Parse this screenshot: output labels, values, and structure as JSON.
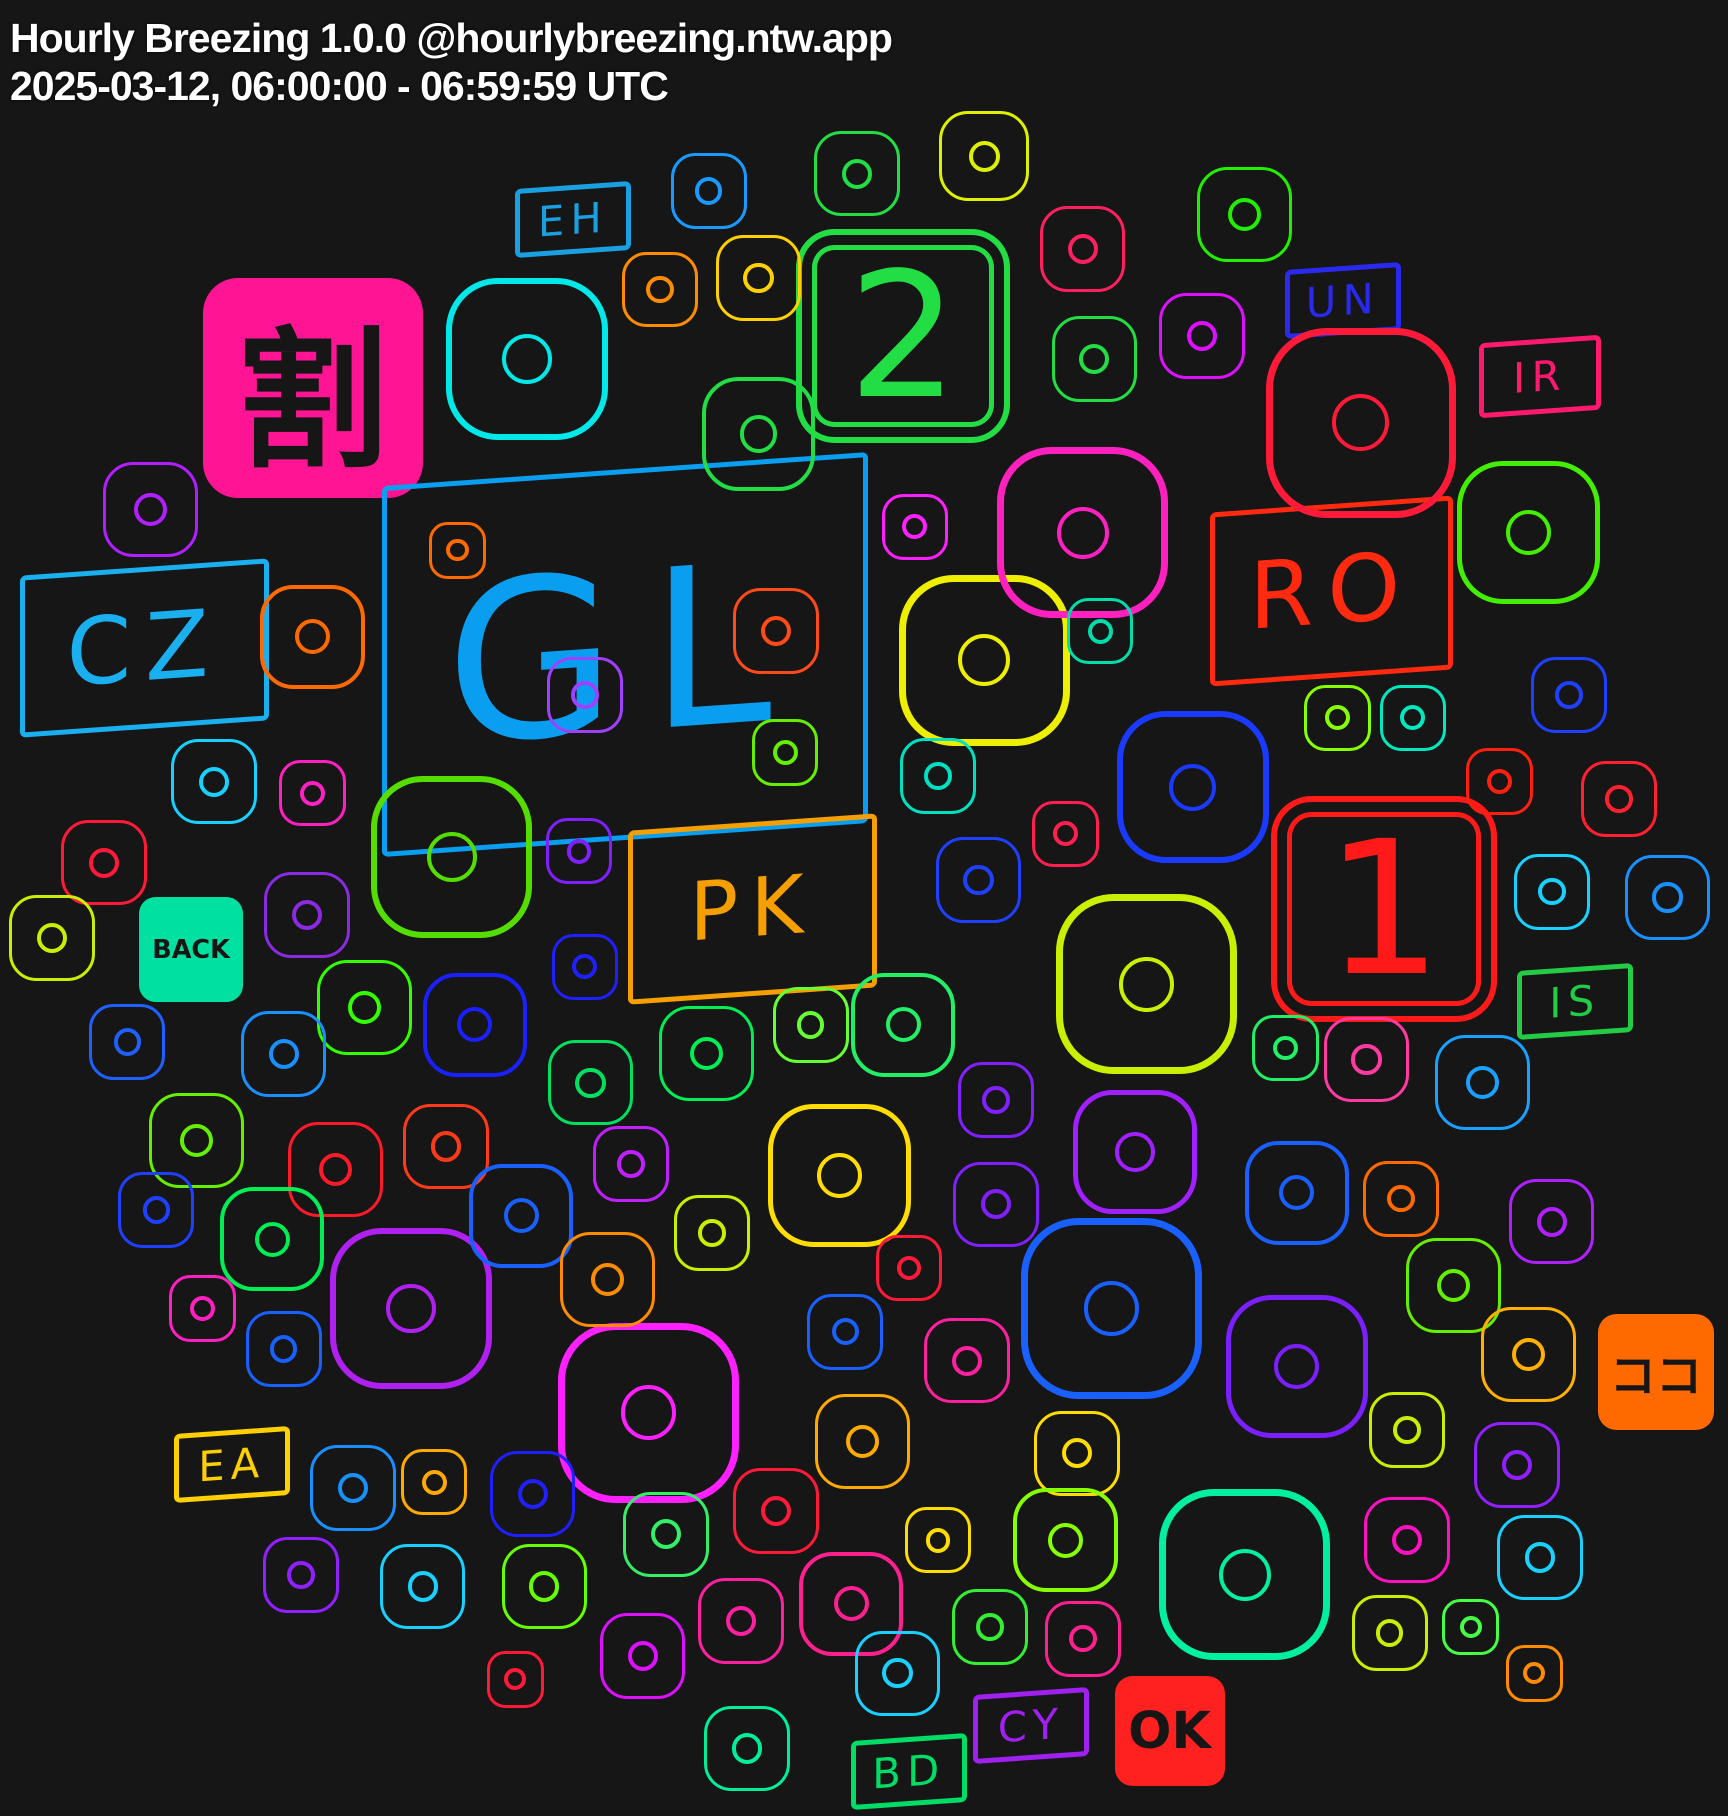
{
  "header": {
    "title": "Hourly Breezing 1.0.0 @hourlybreezing.ntw.app",
    "subtitle": "2025-03-12, 06:00:00 - 06:59:59 UTC"
  },
  "labels": [
    {
      "name": "kanji-discount-box",
      "text": "割",
      "color": "#ff1493",
      "kind": "box"
    },
    {
      "name": "flag-gl",
      "text": "GL",
      "color": "#0a9ef0",
      "kind": "flag"
    },
    {
      "name": "keycap-2",
      "text": "2",
      "color": "#22dd44",
      "kind": "key"
    },
    {
      "name": "keycap-1",
      "text": "1",
      "color": "#ff1a1a",
      "kind": "key"
    },
    {
      "name": "flag-ro",
      "text": "RO",
      "color": "#ff2a10",
      "kind": "flag"
    },
    {
      "name": "flag-cz",
      "text": "CZ",
      "color": "#1ab0f0",
      "kind": "flag"
    },
    {
      "name": "flag-pk",
      "text": "PK",
      "color": "#f5a000",
      "kind": "flag"
    },
    {
      "name": "flag-eh",
      "text": "EH",
      "color": "#1aa0e0",
      "kind": "flag"
    },
    {
      "name": "flag-un",
      "text": "UN",
      "color": "#2a2aee",
      "kind": "flag"
    },
    {
      "name": "flag-ir",
      "text": "IR",
      "color": "#ff1a6e",
      "kind": "flag"
    },
    {
      "name": "flag-is",
      "text": "IS",
      "color": "#22cc44",
      "kind": "flag"
    },
    {
      "name": "flag-ea",
      "text": "EA",
      "color": "#ffd000",
      "kind": "flag"
    },
    {
      "name": "flag-bd",
      "text": "BD",
      "color": "#00dd66",
      "kind": "flag"
    },
    {
      "name": "flag-cy",
      "text": "CY",
      "color": "#a020f0",
      "kind": "flag"
    },
    {
      "name": "koko-box",
      "text": "ココ",
      "color": "#ff6a00",
      "kind": "box"
    },
    {
      "name": "ok-button-box",
      "text": "OK",
      "color": "#ff2020",
      "kind": "box"
    },
    {
      "name": "back-arrow-box",
      "text": "BACK",
      "color": "#00e0a0",
      "kind": "box"
    }
  ],
  "icons": [
    {
      "name": "potable-water-icon",
      "color": "#00f0a0"
    },
    {
      "name": "camel-icon",
      "color": "#00e8e8"
    },
    {
      "name": "magnet-icon",
      "color": "#55dd00"
    },
    {
      "name": "hook-icon",
      "color": "#22dd44"
    },
    {
      "name": "bucket-icon",
      "color": "#1a3aff"
    },
    {
      "name": "hippopotamus-icon",
      "color": "#c8f000"
    },
    {
      "name": "petri-dish-icon",
      "color": "#ff1a3a"
    },
    {
      "name": "woman-face-icon",
      "color": "#44ee00"
    },
    {
      "name": "traffic-light-icon",
      "color": "#ff6a00"
    },
    {
      "name": "flexed-biceps-icon",
      "color": "#b020f0"
    },
    {
      "name": "airplane-icon",
      "color": "#ff20ff"
    },
    {
      "name": "person-cape-icon",
      "color": "#1a60ff"
    },
    {
      "name": "pea-pod-icon",
      "color": "#7a20ff"
    },
    {
      "name": "saw-icon",
      "color": "#eeee00"
    },
    {
      "name": "raised-hands-icon",
      "color": "#ff20c0"
    },
    {
      "name": "clock-green-icon",
      "color": "#22dd44"
    },
    {
      "name": "thumbs-down-icon",
      "color": "#ff8c00"
    },
    {
      "name": "person-haircut-icon",
      "color": "#ffd000"
    },
    {
      "name": "blossom-icon",
      "color": "#1a9aff"
    },
    {
      "name": "hat-icon",
      "color": "#22dd44"
    },
    {
      "name": "arrow-down-right-icon",
      "color": "#ddf000"
    },
    {
      "name": "grid-box-icon",
      "color": "#ff2060"
    },
    {
      "name": "stop-button-icon",
      "color": "#22ee00"
    },
    {
      "name": "magenta-square-icon",
      "color": "#dd10ff"
    },
    {
      "name": "houses-icon",
      "color": "#b020ff"
    },
    {
      "name": "battery-icon",
      "color": "#ff6a00"
    },
    {
      "name": "foot-icon",
      "color": "#ff4a1a"
    },
    {
      "name": "paintbrush-icon",
      "color": "#a040ff"
    },
    {
      "name": "toilet-icon",
      "color": "#66ee00"
    },
    {
      "name": "juggler-icon",
      "color": "#ff20ff"
    },
    {
      "name": "boot-icon",
      "color": "#00ddaa"
    },
    {
      "name": "jar-icon",
      "color": "#88ff00"
    },
    {
      "name": "person-bust-icon",
      "color": "#00e8c0"
    },
    {
      "name": "shopping-bags-icon",
      "color": "#2040ff"
    },
    {
      "name": "shield-icon",
      "color": "#ff2010"
    },
    {
      "name": "woman-face-red-icon",
      "color": "#ff2030"
    },
    {
      "name": "scroll-icon",
      "color": "#1ad0ff"
    },
    {
      "name": "up-arrow-box-icon",
      "color": "#1a90ff"
    },
    {
      "name": "mosquito-icon",
      "color": "#1ad0ff"
    },
    {
      "name": "cup-icon",
      "color": "#ff20c0"
    },
    {
      "name": "spiral-icon",
      "color": "#ff1a3a"
    },
    {
      "name": "hot-dog-icon",
      "color": "#c8ee00"
    },
    {
      "name": "ok-hand-icon",
      "color": "#8020ff"
    },
    {
      "name": "nest-icon",
      "color": "#8a2be2"
    },
    {
      "name": "cartwheel-icon",
      "color": "#00e0c0"
    },
    {
      "name": "chair-icon",
      "color": "#ff2050"
    },
    {
      "name": "guide-dog-icon",
      "color": "#2040ff"
    },
    {
      "name": "shovel-icon",
      "color": "#2020ff"
    },
    {
      "name": "fern-icon",
      "color": "#33ff00"
    },
    {
      "name": "glasses-icon",
      "color": "#1a20ff"
    },
    {
      "name": "grapes-icon",
      "color": "#2060ff"
    },
    {
      "name": "thumbs-right-icon",
      "color": "#1a90ff"
    },
    {
      "name": "hand-green-icon",
      "color": "#00e060"
    },
    {
      "name": "goggles-icon",
      "color": "#00ee55"
    },
    {
      "name": "skunk-icon",
      "color": "#66ff33"
    },
    {
      "name": "link-icon",
      "color": "#22ee66"
    },
    {
      "name": "turkey-icon",
      "color": "#8020ff"
    },
    {
      "name": "person-kneeling-icon",
      "color": "#22ee66"
    },
    {
      "name": "flamingo-icon",
      "color": "#ff3aa0"
    },
    {
      "name": "cinema-icon",
      "color": "#1aa0ff"
    },
    {
      "name": "camel-green-icon",
      "color": "#66ee00"
    },
    {
      "name": "motorcycle-icon",
      "color": "#ff3a1a"
    },
    {
      "name": "bowl-icon",
      "color": "#ff1a2a"
    },
    {
      "name": "pinched-fingers-icon",
      "color": "#c020ff"
    },
    {
      "name": "arrow-left-icon",
      "color": "#ffdd00"
    },
    {
      "name": "tongue-icon",
      "color": "#8020ff"
    },
    {
      "name": "comet-icon",
      "color": "#a020ff"
    },
    {
      "name": "gloves-icon",
      "color": "#1a60ff"
    },
    {
      "name": "breastfeeding-icon",
      "color": "#ff6a00"
    },
    {
      "name": "bamboo-icon",
      "color": "#b020ff"
    },
    {
      "name": "golfer-icon",
      "color": "#2040ff"
    },
    {
      "name": "pickup-truck-icon",
      "color": "#00ee55"
    },
    {
      "name": "curling-stone-icon",
      "color": "#1a60ff"
    },
    {
      "name": "lungs-icon",
      "color": "#ff8c00"
    },
    {
      "name": "elf-icon",
      "color": "#c8ee00"
    },
    {
      "name": "raised-back-hand-icon",
      "color": "#ff1a3a"
    },
    {
      "name": "palm-hand-icon",
      "color": "#1a60ff"
    },
    {
      "name": "radio-icon",
      "color": "#66ee00"
    },
    {
      "name": "ticket-icon",
      "color": "#ffb000"
    },
    {
      "name": "skier-icon",
      "color": "#ff20c0"
    },
    {
      "name": "woman-face-blue-icon",
      "color": "#1a60ff"
    },
    {
      "name": "cook-face-icon",
      "color": "#ff20a0"
    },
    {
      "name": "diamond-pattern-icon",
      "color": "#c8ee00"
    },
    {
      "name": "woman-purple-icon",
      "color": "#9020ff"
    },
    {
      "name": "clock-blue-icon",
      "color": "#1a90ff"
    },
    {
      "name": "giraffe-icon",
      "color": "#ffaa00"
    },
    {
      "name": "megaphone-icon",
      "color": "#2020ff"
    },
    {
      "name": "car-icon",
      "color": "#ffaa00"
    },
    {
      "name": "clock-red-icon",
      "color": "#ff1a3a"
    },
    {
      "name": "classical-building-icon",
      "color": "#ffdd00"
    },
    {
      "name": "goal-net-icon",
      "color": "#88ff00"
    },
    {
      "name": "sign-of-horns-icon",
      "color": "#ffdd00"
    },
    {
      "name": "mens-room-icon",
      "color": "#ff10c0"
    },
    {
      "name": "golf-flag-icon",
      "color": "#1ad0ff"
    },
    {
      "name": "umbrella-icon",
      "color": "#9020ff"
    },
    {
      "name": "no-pedestrians-icon",
      "color": "#1ad0ff"
    },
    {
      "name": "tent-icon",
      "color": "#33ee66"
    },
    {
      "name": "person-surfing-icon",
      "color": "#66ff00"
    },
    {
      "name": "bar-chart-icon",
      "color": "#ff2090"
    },
    {
      "name": "runner-icon",
      "color": "#ff20a0"
    },
    {
      "name": "ghost-icon",
      "color": "#33ee33"
    },
    {
      "name": "firefighter-icon",
      "color": "#ff2090"
    },
    {
      "name": "guard-icon",
      "color": "#c8ee00"
    },
    {
      "name": "sparkle-icon",
      "color": "#44ff44"
    },
    {
      "name": "frowning-face-icon",
      "color": "#ff8c00"
    },
    {
      "name": "opera-icon",
      "color": "#dd10ff"
    },
    {
      "name": "stopwatch-icon",
      "color": "#ff1a3a"
    },
    {
      "name": "bridge-icon",
      "color": "#00ee99"
    },
    {
      "name": "roller-skate-icon",
      "color": "#1ad0ff"
    }
  ]
}
